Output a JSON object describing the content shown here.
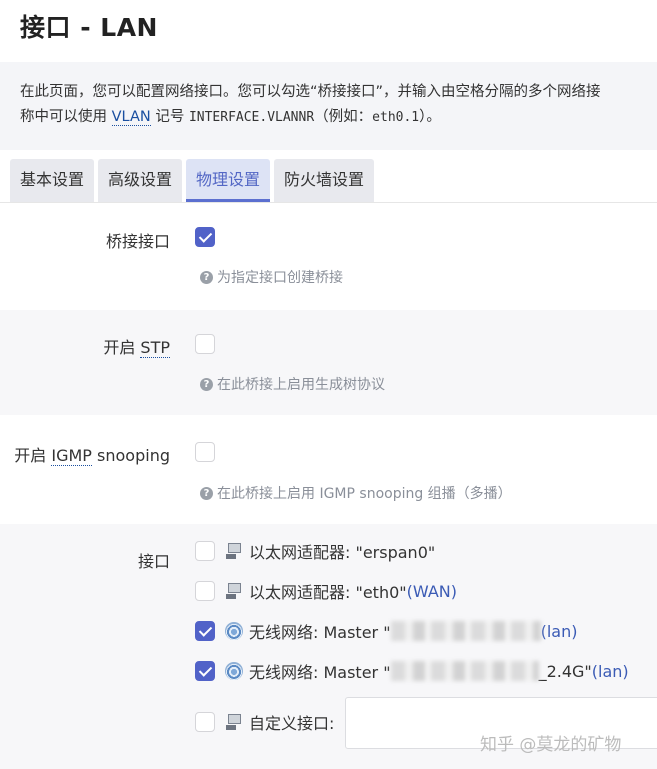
{
  "page": {
    "title": "接口 - LAN",
    "description_line1": "在此页面，您可以配置网络接口。您可以勾选“桥接接口”，并输入由空格分隔的多个网络接",
    "description_line2_pre": "称中可以使用 ",
    "description_line2_abbr": "VLAN",
    "description_line2_mid": " 记号 ",
    "description_line2_code": "INTERFACE.VLANNR",
    "description_line2_post": "（例如：",
    "description_line2_example": "eth0.1",
    "description_line2_end": "）。"
  },
  "tabs": [
    {
      "label": "基本设置"
    },
    {
      "label": "高级设置"
    },
    {
      "label": "物理设置",
      "active": true
    },
    {
      "label": "防火墙设置"
    }
  ],
  "fields": {
    "bridge": {
      "label": "桥接接口",
      "checked": true,
      "hint": "为指定接口创建桥接"
    },
    "stp": {
      "label_pre": "开启 ",
      "label_abbr": "STP",
      "checked": false,
      "hint": "在此桥接上启用生成树协议"
    },
    "igmp": {
      "label_pre": "开启 ",
      "label_abbr": "IGMP",
      "label_post": " snooping",
      "checked": false,
      "hint": "在此桥接上启用 IGMP snooping 组播（多播）"
    },
    "interface": {
      "label": "接口",
      "items": [
        {
          "type": "ethernet",
          "checked": false,
          "text": "以太网适配器: \"erspan0\"",
          "zone": ""
        },
        {
          "type": "ethernet",
          "checked": false,
          "text": "以太网适配器: \"eth0\" ",
          "zone": "(WAN)"
        },
        {
          "type": "wireless",
          "checked": true,
          "text": "无线网络: Master \"",
          "suffix": "",
          "zone": "(lan)"
        },
        {
          "type": "wireless",
          "checked": true,
          "text": "无线网络: Master \"",
          "suffix": "_2.4G\" ",
          "zone": "(lan)"
        },
        {
          "type": "custom",
          "checked": false,
          "text": "自定义接口:",
          "zone": ""
        }
      ]
    }
  },
  "watermark": "知乎 @莫龙的矿物",
  "colors": {
    "accent": "#5162c8",
    "link": "#3b5bb5",
    "hint": "#8a8f99"
  }
}
